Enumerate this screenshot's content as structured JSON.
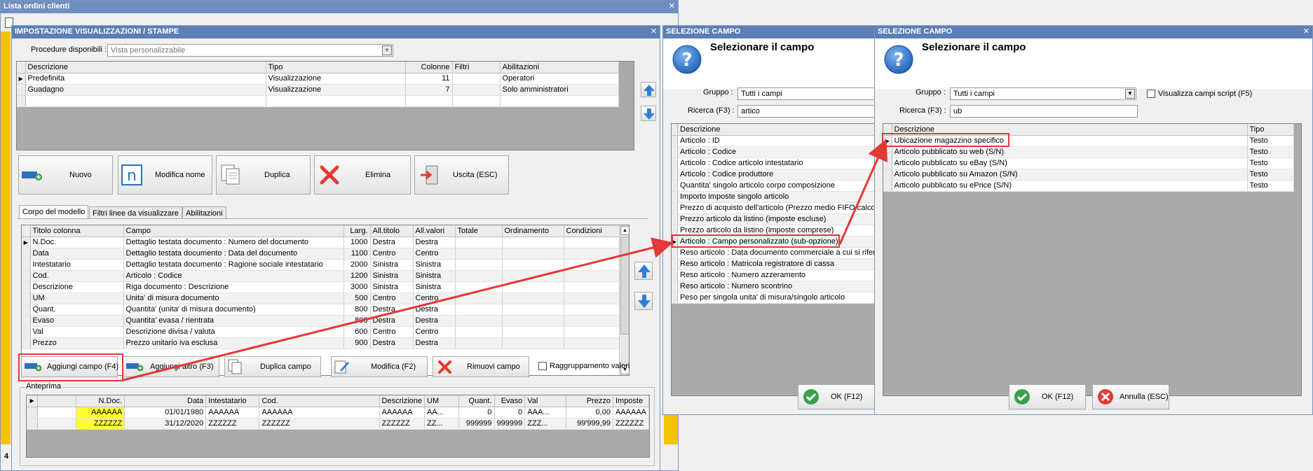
{
  "bg_window": {
    "title": "Lista ordini clienti",
    "tail_left": "4"
  },
  "main_dialog": {
    "title": "IMPOSTAZIONE VISUALIZZAZIONI / STAMPE",
    "procedure_label": "Procedure disponibili :",
    "procedure_value": "Vista personalizzabile",
    "views": {
      "columns": [
        "Descrizione",
        "Tipo",
        "Colonne",
        "Filtri",
        "Abilitazioni"
      ],
      "rows": [
        [
          "Predefinita",
          "Visualizzazione",
          "11",
          "",
          "Operatori"
        ],
        [
          "Guadagno",
          "Visualizzazione",
          "7",
          "",
          "Solo amministratori"
        ]
      ]
    },
    "buttons": {
      "nuovo": "Nuovo",
      "modifica_nome": "Modifica nome",
      "duplica": "Duplica",
      "elimina": "Elimina",
      "uscita": "Uscita (ESC)"
    },
    "tabs": [
      "Corpo del modello",
      "Filtri linee da visualizzare",
      "Abilitazioni"
    ],
    "fields": {
      "columns": [
        "Titolo colonna",
        "Campo",
        "Larg.",
        "All.titolo",
        "All.valori",
        "Totale",
        "Ordinamento",
        "Condizioni"
      ],
      "rows": [
        [
          "N.Doc.",
          "Dettaglio testata documento : Numero del documento",
          "1000",
          "Destra",
          "Destra",
          "",
          "",
          ""
        ],
        [
          "Data",
          "Dettaglio testata documento : Data del documento",
          "1100",
          "Centro",
          "Centro",
          "",
          "",
          ""
        ],
        [
          "Intestatario",
          "Dettaglio testata documento : Ragione sociale intestatario",
          "2000",
          "Sinistra",
          "Sinistra",
          "",
          "",
          ""
        ],
        [
          "Cod.",
          "Articolo : Codice",
          "1200",
          "Sinistra",
          "Sinistra",
          "",
          "",
          ""
        ],
        [
          "Descrizione",
          "Riga documento : Descrizione",
          "3000",
          "Sinistra",
          "Sinistra",
          "",
          "",
          ""
        ],
        [
          "UM",
          "Unita' di misura documento",
          "500",
          "Centro",
          "Centro",
          "",
          "",
          ""
        ],
        [
          "Quant.",
          "Quantita' (unita' di misura documento)",
          "800",
          "Destra",
          "Destra",
          "",
          "",
          ""
        ],
        [
          "Evaso",
          "Quantita' evasa / rientrata",
          "800",
          "Destra",
          "Destra",
          "",
          "",
          ""
        ],
        [
          "Val",
          "Descrizione divisa / valuta",
          "600",
          "Centro",
          "Centro",
          "",
          "",
          ""
        ],
        [
          "Prezzo",
          "Prezzo unitario iva esclusa",
          "900",
          "Destra",
          "Destra",
          "",
          "",
          ""
        ]
      ]
    },
    "field_buttons": {
      "aggiungi_campo": "Aggiungi campo (F4)",
      "aggiungi_altro": "Aggiungi altro (F3)",
      "duplica_campo": "Duplica campo",
      "modifica": "Modifica (F2)",
      "rimuovi_campo": "Rimuovi campo",
      "raggruppamento": "Raggruppamento valori"
    },
    "preview": {
      "label": "Anteprima",
      "columns": [
        "N.Doc.",
        "Data",
        "Intestatario",
        "Cod.",
        "Descrizione",
        "UM",
        "Quant.",
        "Evaso",
        "Val",
        "Prezzo",
        "Imposte"
      ],
      "rows": [
        [
          "AAAAAA",
          "01/01/1980",
          "AAAAAA",
          "AAAAAA",
          "AAAAAA",
          "AA...",
          "0",
          "0",
          "AAA...",
          "0,00",
          "AAAAAA"
        ],
        [
          "ZZZZZZ",
          "31/12/2020",
          "ZZZZZZ",
          "ZZZZZZ",
          "ZZZZZZ",
          "ZZ...",
          "999999",
          "999999",
          "ZZZ...",
          "99'999,99",
          "ZZZZZZ"
        ]
      ]
    }
  },
  "select1": {
    "title": "SELEZIONE CAMPO",
    "heading": "Selezionare il campo",
    "gruppo_label": "Gruppo :",
    "gruppo_value": "Tutti i campi",
    "ricerca_label": "Ricerca (F3) :",
    "ricerca_value": "artico",
    "column": "Descrizione",
    "rows": [
      "Articolo : ID",
      "Articolo : Codice",
      "Articolo : Codice articolo intestatario",
      "Articolo : Codice produttore",
      "Quantita' singolo articolo corpo composizione",
      "Importo imposte singolo articolo",
      "Prezzo di acquisto dell'articolo (Prezzo medio FIFO calcola",
      "Prezzo articolo da listino (imposte escluse)",
      "Prezzo articolo da listino (imposte comprese)",
      "Articolo : Campo personalizzato (sub-opzione)",
      "Reso articolo : Data documento commerciale a cui si riferis",
      "Reso articolo : Matricola registratore di cassa",
      "Reso articolo : Numero azzeramento",
      "Reso articolo : Numero scontrino",
      "Peso per singola unita' di misura/singolo articolo"
    ],
    "ok": "OK (F12)"
  },
  "select2": {
    "title": "SELEZIONE CAMPO",
    "heading": "Selezionare il campo",
    "gruppo_label": "Gruppo :",
    "gruppo_value": "Tutti i campi",
    "script_label": "Visualizza campi script (F5)",
    "ricerca_label": "Ricerca (F3) :",
    "ricerca_value": "ub",
    "columns": [
      "Descrizione",
      "Tipo"
    ],
    "rows": [
      [
        "Ubicazione magazzino specifico",
        "Testo"
      ],
      [
        "Articolo pubblicato su web (S/N)",
        "Testo"
      ],
      [
        "Articolo pubblicato su eBay (S/N)",
        "Testo"
      ],
      [
        "Articolo pubblicato su Amazon (S/N)",
        "Testo"
      ],
      [
        "Articolo pubblicato su ePrice (S/N)",
        "Testo"
      ]
    ],
    "ok": "OK (F12)",
    "annulla": "Annulla (ESC)"
  },
  "colors": {
    "titlebar": "#5b7fb6",
    "highlight": "#e53935",
    "preview_yellow": "#ffff33",
    "arrow_blue": "#2f7fd6"
  }
}
